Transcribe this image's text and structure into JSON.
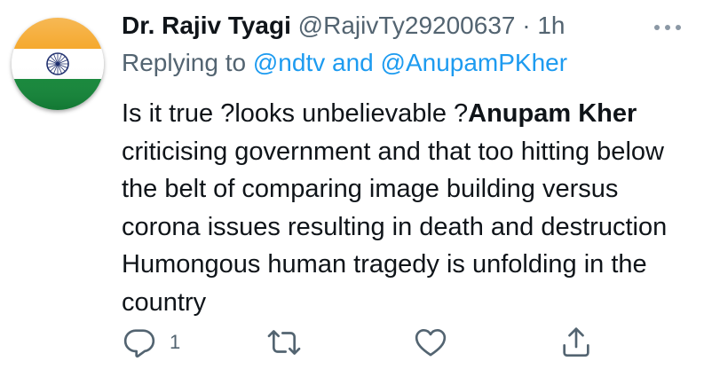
{
  "tweet": {
    "author": {
      "display_name": "Dr. Rajiv Tyagi",
      "handle": "@RajivTy29200637",
      "separator": "·",
      "time": "1h",
      "avatar": "india-flag-avatar"
    },
    "reply": {
      "prefix": "Replying to",
      "mention1": "@ndtv",
      "conjunction": "and",
      "mention2": "@AnupamPKher"
    },
    "body": {
      "part1": "Is it true ?looks unbelievable ?",
      "bold": "Anupam Kher",
      "part2": " criticising government and that too hitting below the belt of comparing image building versus corona issues resulting in death and destruction Humongous human tragedy is unfolding in the country"
    },
    "actions": {
      "reply_count": "1",
      "reply_icon": "reply-icon",
      "retweet_icon": "retweet-icon",
      "like_icon": "like-icon",
      "share_icon": "share-icon"
    },
    "colors": {
      "link": "#1d9bf0",
      "secondary": "#536471",
      "text": "#0f1419",
      "saffron": "#f4a11c",
      "green": "#15883a",
      "chakra": "#1f2f6e"
    }
  }
}
